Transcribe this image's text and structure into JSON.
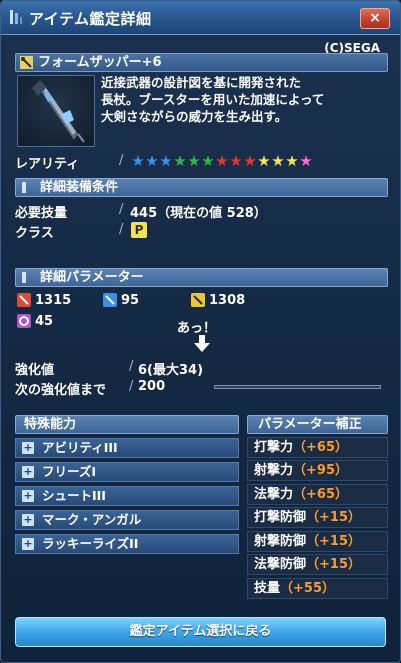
{
  "window": {
    "title": "アイテム鑑定詳細",
    "close_label": "×"
  },
  "copyright": "(C)SEGA",
  "item": {
    "name": "フォームザッパー+6",
    "description_lines": [
      "近接武器の設計図を基に開発された",
      "長杖。ブースターを用いた加速によって",
      "大剣さながらの威力を生み出す。"
    ]
  },
  "rarity": {
    "label": "レアリティ",
    "stars": [
      "#3a8fe8",
      "#3a8fe8",
      "#3a8fe8",
      "#2fb54a",
      "#2fb54a",
      "#2fb54a",
      "#e6362b",
      "#e6362b",
      "#e6362b",
      "#f3e35a",
      "#f3e35a",
      "#f3e35a",
      "#ff6ad5"
    ]
  },
  "requirements": {
    "header": "詳細装備条件",
    "skill_label": "必要技量",
    "skill_value": "445（現在の値 528）",
    "class_label": "クラス",
    "class_icon_text": "P"
  },
  "params": {
    "header": "詳細パラメーター",
    "strike": "1315",
    "shot": "95",
    "tech": "1308",
    "dex": "45"
  },
  "annotation": "あっ！",
  "grind": {
    "label": "強化値",
    "value": "6(最大34)",
    "next_label": "次の強化値まで",
    "next_value": "200",
    "progress": 0
  },
  "abilities": {
    "header": "特殊能力",
    "items": [
      "アビリティIII",
      "フリーズI",
      "シュートIII",
      "マーク・アンガル",
      "ラッキーライズII"
    ]
  },
  "bonuses": {
    "header": "パラメーター補正",
    "items": [
      {
        "label": "打撃力",
        "value": "（+65）"
      },
      {
        "label": "射撃力",
        "value": "（+95）"
      },
      {
        "label": "法撃力",
        "value": "（+65）"
      },
      {
        "label": "打撃防御",
        "value": "（+15）"
      },
      {
        "label": "射撃防御",
        "value": "（+15）"
      },
      {
        "label": "法撃防御",
        "value": "（+15）"
      },
      {
        "label": "技量",
        "value": "（+55）"
      }
    ]
  },
  "footer": {
    "return_label": "鑑定アイテム選択に戻る"
  }
}
